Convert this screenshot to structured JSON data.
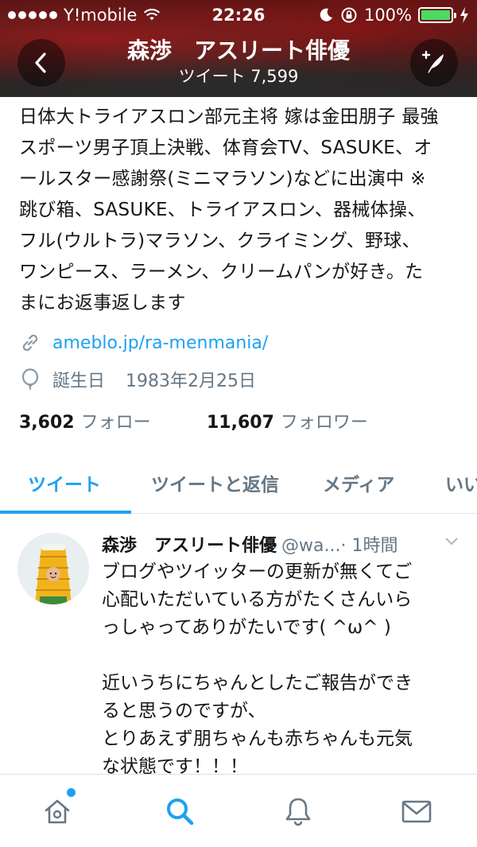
{
  "status_bar": {
    "carrier": "Y!mobile",
    "time": "22:26",
    "battery_percent": "100%",
    "battery_level": 1.0,
    "battery_color": "#4cd964"
  },
  "header": {
    "title": "森渉　アスリート俳優",
    "subtitle": "ツイート 7,599",
    "back_icon": "chevron-left-icon",
    "compose_icon": "compose-tweet-icon"
  },
  "profile": {
    "bio_lines": [
      "日体大トライアスロン部元主将 嫁は金田朋子 最強",
      "スポーツ男子頂上決戦、体育会TV、SASUKE、オ",
      "ールスター感謝祭(ミニマラソン)などに出演中 ※",
      "跳び箱、SASUKE、トライアスロン、器械体操、",
      "フル(ウルトラ)マラソン、クライミング、野球、",
      "ワンピース、ラーメン、クリームパンが好き。た",
      "まにお返事返します"
    ],
    "link": "ameblo.jp/ra-menmania/",
    "birthday_label": "誕生日",
    "birthday": "1983年2月25日",
    "following_count": "3,602",
    "following_label": "フォロー",
    "followers_count": "11,607",
    "followers_label": "フォロワー"
  },
  "tabs": [
    {
      "label": "ツイート",
      "active": true
    },
    {
      "label": "ツイートと返信",
      "active": false
    },
    {
      "label": "メディア",
      "active": false
    },
    {
      "label": "いいね",
      "active": false
    }
  ],
  "tweet": {
    "name": "森渉　アスリート俳優",
    "handle": "@wa...",
    "time": "· 1時間",
    "text_block1": [
      "ブログやツイッターの更新が無くてご",
      "心配いただいている方がたくさんいら",
      "っしゃってありがたいです( ^ω^ )"
    ],
    "text_block2": [
      "近いうちにちゃんとしたご報告ができ",
      "ると思うのですが、",
      "とりあえず朋ちゃんも赤ちゃんも元気",
      "な状態です！！！"
    ]
  },
  "bottom_nav": {
    "items": [
      "home-icon",
      "search-icon",
      "notifications-icon",
      "messages-icon"
    ],
    "active": "search-icon",
    "accent_color": "#1da1f2",
    "inactive_color": "#657786"
  }
}
